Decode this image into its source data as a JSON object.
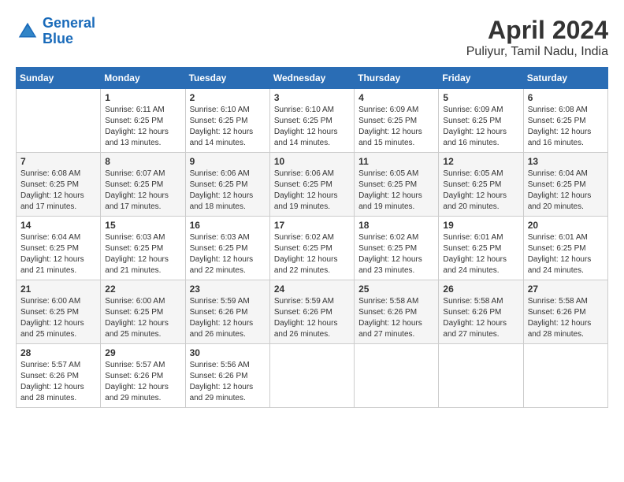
{
  "logo": {
    "line1": "General",
    "line2": "Blue"
  },
  "title": "April 2024",
  "subtitle": "Puliyur, Tamil Nadu, India",
  "days_of_week": [
    "Sunday",
    "Monday",
    "Tuesday",
    "Wednesday",
    "Thursday",
    "Friday",
    "Saturday"
  ],
  "weeks": [
    [
      {
        "num": "",
        "sunrise": "",
        "sunset": "",
        "daylight": "",
        "empty": true
      },
      {
        "num": "1",
        "sunrise": "Sunrise: 6:11 AM",
        "sunset": "Sunset: 6:25 PM",
        "daylight": "Daylight: 12 hours and 13 minutes."
      },
      {
        "num": "2",
        "sunrise": "Sunrise: 6:10 AM",
        "sunset": "Sunset: 6:25 PM",
        "daylight": "Daylight: 12 hours and 14 minutes."
      },
      {
        "num": "3",
        "sunrise": "Sunrise: 6:10 AM",
        "sunset": "Sunset: 6:25 PM",
        "daylight": "Daylight: 12 hours and 14 minutes."
      },
      {
        "num": "4",
        "sunrise": "Sunrise: 6:09 AM",
        "sunset": "Sunset: 6:25 PM",
        "daylight": "Daylight: 12 hours and 15 minutes."
      },
      {
        "num": "5",
        "sunrise": "Sunrise: 6:09 AM",
        "sunset": "Sunset: 6:25 PM",
        "daylight": "Daylight: 12 hours and 16 minutes."
      },
      {
        "num": "6",
        "sunrise": "Sunrise: 6:08 AM",
        "sunset": "Sunset: 6:25 PM",
        "daylight": "Daylight: 12 hours and 16 minutes."
      }
    ],
    [
      {
        "num": "7",
        "sunrise": "Sunrise: 6:08 AM",
        "sunset": "Sunset: 6:25 PM",
        "daylight": "Daylight: 12 hours and 17 minutes."
      },
      {
        "num": "8",
        "sunrise": "Sunrise: 6:07 AM",
        "sunset": "Sunset: 6:25 PM",
        "daylight": "Daylight: 12 hours and 17 minutes."
      },
      {
        "num": "9",
        "sunrise": "Sunrise: 6:06 AM",
        "sunset": "Sunset: 6:25 PM",
        "daylight": "Daylight: 12 hours and 18 minutes."
      },
      {
        "num": "10",
        "sunrise": "Sunrise: 6:06 AM",
        "sunset": "Sunset: 6:25 PM",
        "daylight": "Daylight: 12 hours and 19 minutes."
      },
      {
        "num": "11",
        "sunrise": "Sunrise: 6:05 AM",
        "sunset": "Sunset: 6:25 PM",
        "daylight": "Daylight: 12 hours and 19 minutes."
      },
      {
        "num": "12",
        "sunrise": "Sunrise: 6:05 AM",
        "sunset": "Sunset: 6:25 PM",
        "daylight": "Daylight: 12 hours and 20 minutes."
      },
      {
        "num": "13",
        "sunrise": "Sunrise: 6:04 AM",
        "sunset": "Sunset: 6:25 PM",
        "daylight": "Daylight: 12 hours and 20 minutes."
      }
    ],
    [
      {
        "num": "14",
        "sunrise": "Sunrise: 6:04 AM",
        "sunset": "Sunset: 6:25 PM",
        "daylight": "Daylight: 12 hours and 21 minutes."
      },
      {
        "num": "15",
        "sunrise": "Sunrise: 6:03 AM",
        "sunset": "Sunset: 6:25 PM",
        "daylight": "Daylight: 12 hours and 21 minutes."
      },
      {
        "num": "16",
        "sunrise": "Sunrise: 6:03 AM",
        "sunset": "Sunset: 6:25 PM",
        "daylight": "Daylight: 12 hours and 22 minutes."
      },
      {
        "num": "17",
        "sunrise": "Sunrise: 6:02 AM",
        "sunset": "Sunset: 6:25 PM",
        "daylight": "Daylight: 12 hours and 22 minutes."
      },
      {
        "num": "18",
        "sunrise": "Sunrise: 6:02 AM",
        "sunset": "Sunset: 6:25 PM",
        "daylight": "Daylight: 12 hours and 23 minutes."
      },
      {
        "num": "19",
        "sunrise": "Sunrise: 6:01 AM",
        "sunset": "Sunset: 6:25 PM",
        "daylight": "Daylight: 12 hours and 24 minutes."
      },
      {
        "num": "20",
        "sunrise": "Sunrise: 6:01 AM",
        "sunset": "Sunset: 6:25 PM",
        "daylight": "Daylight: 12 hours and 24 minutes."
      }
    ],
    [
      {
        "num": "21",
        "sunrise": "Sunrise: 6:00 AM",
        "sunset": "Sunset: 6:25 PM",
        "daylight": "Daylight: 12 hours and 25 minutes."
      },
      {
        "num": "22",
        "sunrise": "Sunrise: 6:00 AM",
        "sunset": "Sunset: 6:25 PM",
        "daylight": "Daylight: 12 hours and 25 minutes."
      },
      {
        "num": "23",
        "sunrise": "Sunrise: 5:59 AM",
        "sunset": "Sunset: 6:26 PM",
        "daylight": "Daylight: 12 hours and 26 minutes."
      },
      {
        "num": "24",
        "sunrise": "Sunrise: 5:59 AM",
        "sunset": "Sunset: 6:26 PM",
        "daylight": "Daylight: 12 hours and 26 minutes."
      },
      {
        "num": "25",
        "sunrise": "Sunrise: 5:58 AM",
        "sunset": "Sunset: 6:26 PM",
        "daylight": "Daylight: 12 hours and 27 minutes."
      },
      {
        "num": "26",
        "sunrise": "Sunrise: 5:58 AM",
        "sunset": "Sunset: 6:26 PM",
        "daylight": "Daylight: 12 hours and 27 minutes."
      },
      {
        "num": "27",
        "sunrise": "Sunrise: 5:58 AM",
        "sunset": "Sunset: 6:26 PM",
        "daylight": "Daylight: 12 hours and 28 minutes."
      }
    ],
    [
      {
        "num": "28",
        "sunrise": "Sunrise: 5:57 AM",
        "sunset": "Sunset: 6:26 PM",
        "daylight": "Daylight: 12 hours and 28 minutes."
      },
      {
        "num": "29",
        "sunrise": "Sunrise: 5:57 AM",
        "sunset": "Sunset: 6:26 PM",
        "daylight": "Daylight: 12 hours and 29 minutes."
      },
      {
        "num": "30",
        "sunrise": "Sunrise: 5:56 AM",
        "sunset": "Sunset: 6:26 PM",
        "daylight": "Daylight: 12 hours and 29 minutes."
      },
      {
        "num": "",
        "sunrise": "",
        "sunset": "",
        "daylight": "",
        "empty": true
      },
      {
        "num": "",
        "sunrise": "",
        "sunset": "",
        "daylight": "",
        "empty": true
      },
      {
        "num": "",
        "sunrise": "",
        "sunset": "",
        "daylight": "",
        "empty": true
      },
      {
        "num": "",
        "sunrise": "",
        "sunset": "",
        "daylight": "",
        "empty": true
      }
    ]
  ]
}
